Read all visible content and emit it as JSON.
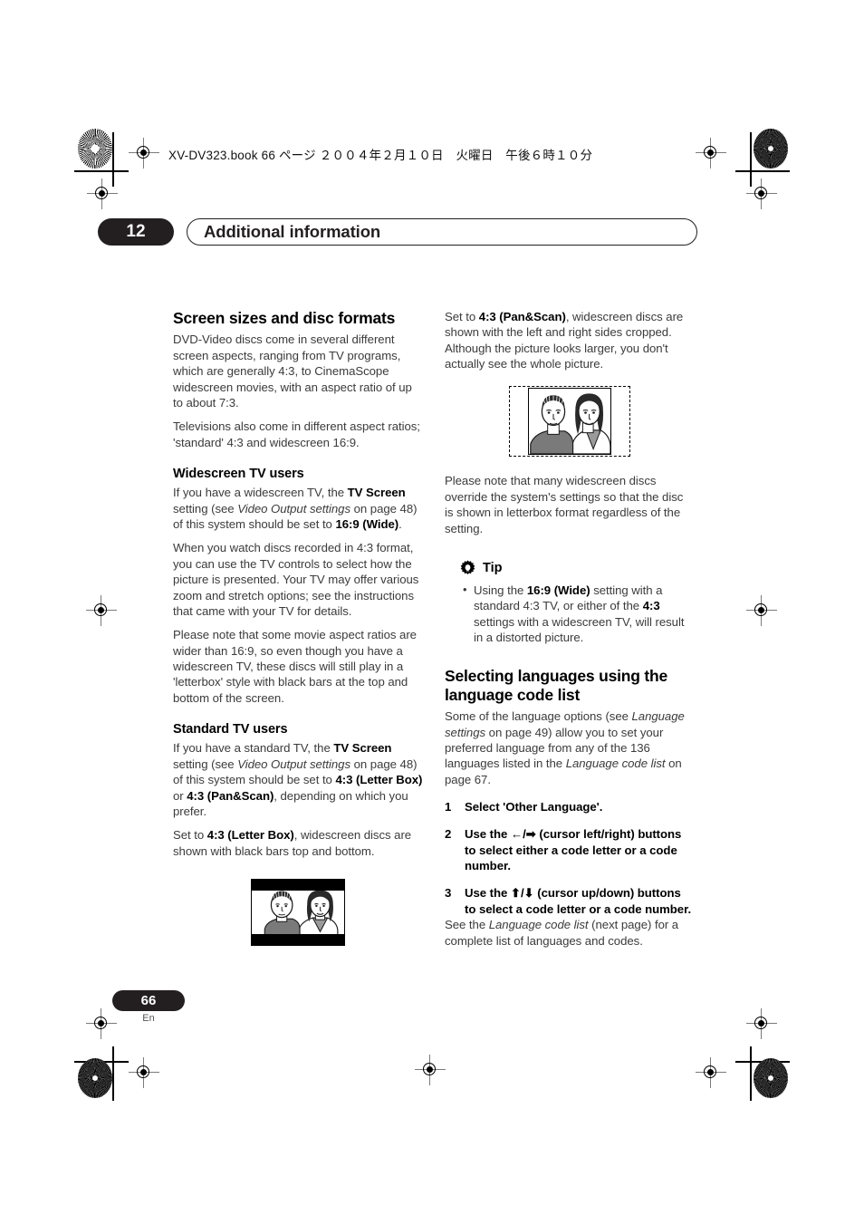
{
  "print_header": {
    "text": "XV-DV323.book  66 ページ  ２００４年２月１０日　火曜日　午後６時１０分"
  },
  "chapter": {
    "number": "12",
    "title": "Additional information"
  },
  "left_column": {
    "section_title": "Screen sizes and disc formats",
    "intro_paragraphs": [
      "DVD-Video discs come in several different screen aspects, ranging from TV programs, which are generally 4:3, to CinemaScope widescreen movies, with an aspect ratio of up to about 7:3.",
      "Televisions also come in different aspect ratios; 'standard' 4:3 and widescreen 16:9."
    ],
    "widescreen": {
      "heading": "Widescreen TV users",
      "p1_a": "If you have a widescreen TV, the ",
      "p1_b": "TV Screen",
      "p1_c": " setting (see ",
      "p1_d": "Video Output settings",
      "p1_e": " on page 48) of this system should be set to ",
      "p1_f": "16:9 (Wide)",
      "p1_g": ".",
      "p2": "When you watch discs recorded in 4:3 format, you can use the TV controls to select how the picture is presented. Your TV may offer various zoom and stretch options; see the instructions that came with your TV for details.",
      "p3": "Please note that some movie aspect ratios are wider than 16:9, so even though you have a widescreen TV, these discs will still play in a 'letterbox' style with black bars at the top and bottom of the screen."
    },
    "standard": {
      "heading": "Standard TV users",
      "p1_a": "If you have a standard TV, the ",
      "p1_b": "TV Screen",
      "p1_c": " setting (see ",
      "p1_d": "Video Output settings",
      "p1_e": " on page 48) of this system should be set to ",
      "p1_f": "4:3 (Letter Box)",
      "p1_g": " or ",
      "p1_h": "4:3 (Pan&Scan)",
      "p1_i": ", depending on which you prefer.",
      "p2_a": "Set to ",
      "p2_b": "4:3 (Letter Box)",
      "p2_c": ", widescreen discs are shown with black bars top and bottom."
    },
    "figure_letterbox": "letterbox-tv-illustration"
  },
  "right_column": {
    "panscan": {
      "p1_a": "Set to ",
      "p1_b": "4:3 (Pan&Scan)",
      "p1_c": ", widescreen discs are shown with the left and right sides cropped. Although the picture looks larger, you don't actually see the whole picture."
    },
    "figure_panscan": "panscan-crop-illustration",
    "note": "Please note that many widescreen discs override the system's settings so that the disc is shown in letterbox format regardless of the setting.",
    "tip": {
      "icon": "gear-icon",
      "label": "Tip",
      "bullet_a": "Using the ",
      "bullet_b": "16:9 (Wide)",
      "bullet_c": " setting with a standard 4:3 TV, or either of the ",
      "bullet_d": "4:3",
      "bullet_e": " settings with a widescreen TV, will result in a distorted picture."
    },
    "languages": {
      "heading": "Selecting languages using the language code list",
      "intro_a": "Some of the language options (see ",
      "intro_b": "Language settings",
      "intro_c": " on page 49) allow you to set your preferred language from any of the 136 languages listed in the ",
      "intro_d": "Language code list",
      "intro_e": " on page 67.",
      "steps": [
        {
          "num": "1",
          "text": "Select 'Other Language'.",
          "arrows": ""
        },
        {
          "num": "2",
          "pre": "Use the ",
          "arrows": "←/➡",
          "post": " (cursor left/right) buttons to select either a code letter or a code number."
        },
        {
          "num": "3",
          "pre": "Use the ",
          "arrows": "⬆/⬇",
          "post": " (cursor up/down) buttons to select a code letter or a code number."
        }
      ],
      "step3_note_a": "See the ",
      "step3_note_b": "Language code list",
      "step3_note_c": " (next page) for a complete list of languages and codes."
    }
  },
  "footer": {
    "page_number": "66",
    "language_code": "En"
  },
  "colors": {
    "ink": "#231f20",
    "body_text": "#3b3b3b",
    "paper": "#ffffff"
  }
}
